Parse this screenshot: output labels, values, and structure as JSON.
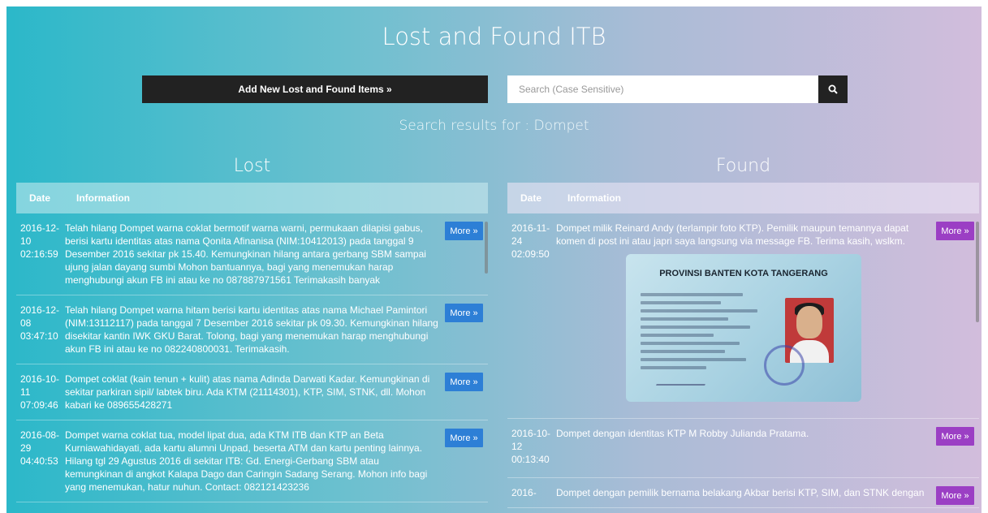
{
  "header": {
    "title": "Lost and Found ITB",
    "add_button": "Add New Lost and Found Items »",
    "search_placeholder": "Search (Case Sensitive)",
    "search_icon": "search-icon"
  },
  "results": {
    "text": "Search results for : Dompet"
  },
  "lost": {
    "title": "Lost",
    "col_date": "Date",
    "col_info": "Information",
    "rows": [
      {
        "date": "2016-12-10 02:16:59",
        "info": "Telah hilang Dompet warna coklat bermotif warna warni, permukaan dilapisi gabus, berisi kartu identitas atas nama Qonita Afinanisa (NIM:10412013) pada tanggal 9 Desember 2016 sekitar pk 15.40. Kemungkinan hilang antara gerbang SBM sampai ujung jalan dayang sumbi Mohon bantuannya, bagi yang menemukan harap menghubungi akun FB ini atau ke no 087887971561 Terimakasih banyak",
        "more": "More »"
      },
      {
        "date": "2016-12-08 03:47:10",
        "info": "Telah hilang Dompet warna hitam berisi kartu identitas atas nama Michael Pamintori (NIM:13112117) pada tanggal 7 Desember 2016 sekitar pk 09.30. Kemungkinan hilang disekitar kantin IWK GKU Barat. Tolong, bagi yang menemukan harap menghubungi akun FB ini atau ke no 082240800031. Terimakasih.",
        "more": "More »"
      },
      {
        "date": "2016-10-11 07:09:46",
        "info": "Dompet coklat (kain tenun + kulit) atas nama Adinda Darwati Kadar. Kemungkinan di sekitar parkiran sipil/ labtek biru. Ada KTM (21114301), KTP, SIM, STNK, dll. Mohon kabari ke 089655428271",
        "more": "More »"
      },
      {
        "date": "2016-08-29 04:40:53",
        "info": "Dompet warna coklat tua, model lipat dua, ada KTM ITB dan KTP an Beta Kurniawahidayati, ada kartu alumni Unpad, beserta ATM dan kartu penting lainnya. Hilang tgl 29 Agustus 2016 di sekitar ITB: Gd. Energi-Gerbang SBM atau kemungkinan di angkot Kalapa Dago dan Caringin Sadang Serang. Mohon info bagi yang menemukan, hatur nuhun. Contact: 082121423236",
        "more": "More »"
      }
    ]
  },
  "found": {
    "title": "Found",
    "col_date": "Date",
    "col_info": "Information",
    "rows": [
      {
        "date": "2016-11-24 02:09:50",
        "info": "Dompet milik Reinard Andy (terlampir foto KTP). Pemilik maupun temannya dapat komen di post ini atau japri saya langsung via message FB. Terima kasih, wslkm.",
        "more": "More »",
        "ktp_header": "PROVINSI BANTEN KOTA TANGERANG"
      },
      {
        "date": "2016-10-12 00:13:40",
        "info": "Dompet dengan identitas KTP M Robby Julianda Pratama.",
        "more": "More »"
      },
      {
        "date": "2016-",
        "info": "Dompet dengan pemilik bernama belakang Akbar berisi KTP, SIM, dan STNK dengan",
        "more": "More »"
      }
    ]
  }
}
